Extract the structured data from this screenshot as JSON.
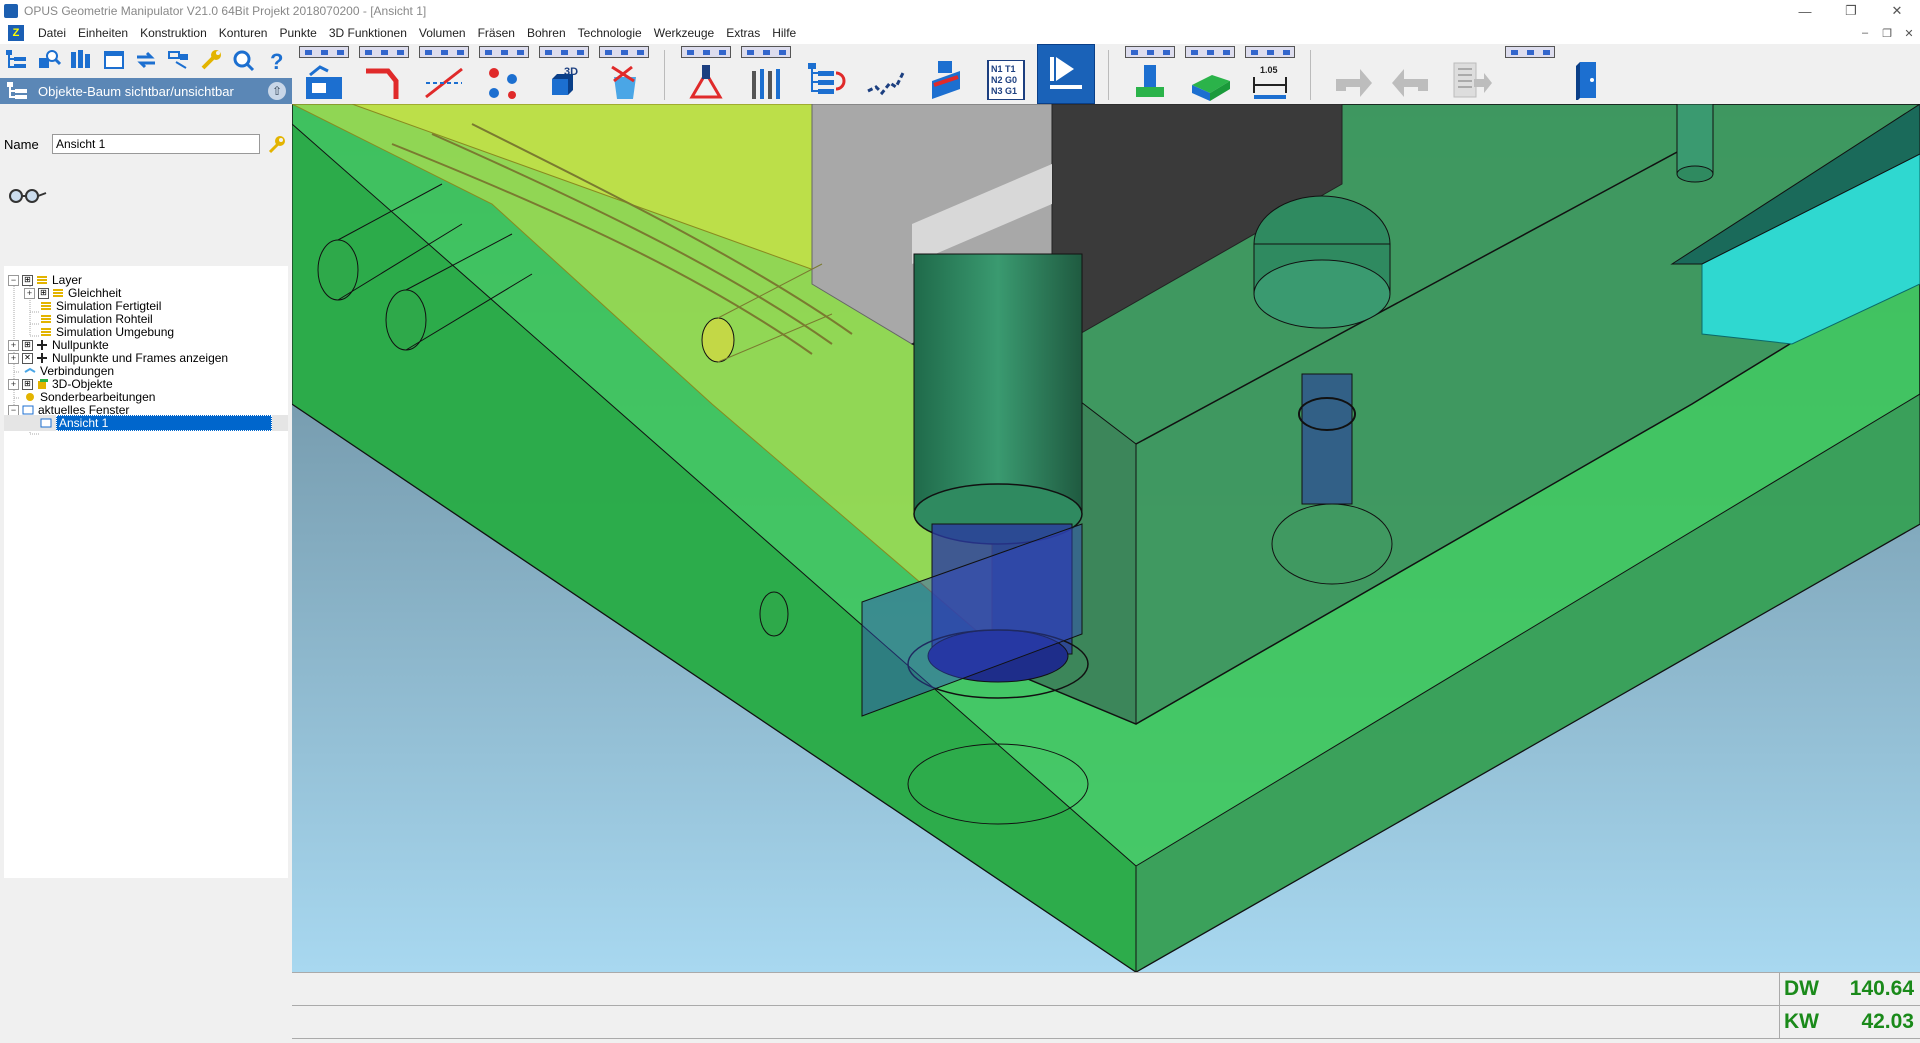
{
  "window": {
    "title": "OPUS Geometrie Manipulator V21.0 64Bit  Projekt 2018070200      - [Ansicht 1]"
  },
  "menu": [
    "Datei",
    "Einheiten",
    "Konstruktion",
    "Konturen",
    "Punkte",
    "3D Funktionen",
    "Volumen",
    "Fräsen",
    "Bohren",
    "Technologie",
    "Werkzeuge",
    "Extras",
    "Hilfe"
  ],
  "toolbar": {
    "label_3d": "3D",
    "nc_lines": [
      "N1 T1",
      "N2 G0",
      "N3 G1"
    ],
    "measure_value": "1.05"
  },
  "sidebar": {
    "header": "Objekte-Baum sichtbar/unsichtbar",
    "name_label": "Name",
    "name_value": "Ansicht 1"
  },
  "tree": [
    {
      "label": "Layer"
    },
    {
      "label": "Gleichheit"
    },
    {
      "label": "Simulation Fertigteil"
    },
    {
      "label": "Simulation Rohteil"
    },
    {
      "label": "Simulation Umgebung"
    },
    {
      "label": "Nullpunkte"
    },
    {
      "label": "Nullpunkte und Frames anzeigen"
    },
    {
      "label": "Verbindungen"
    },
    {
      "label": "3D-Objekte"
    },
    {
      "label": "Sonderbearbeitungen"
    },
    {
      "label": "aktuelles Fenster"
    },
    {
      "label": "Ansicht 1",
      "selected": true
    }
  ],
  "status": {
    "dw_label": "DW",
    "dw_value": "140.64",
    "kw_label": "KW",
    "kw_value": "42.03"
  },
  "colors": {
    "accent": "#1a62b8",
    "readout": "#1a8a1a",
    "part_green": "#3cc85a",
    "bg_top": "#5e7e8e",
    "bg_bottom": "#a8d8f0"
  }
}
